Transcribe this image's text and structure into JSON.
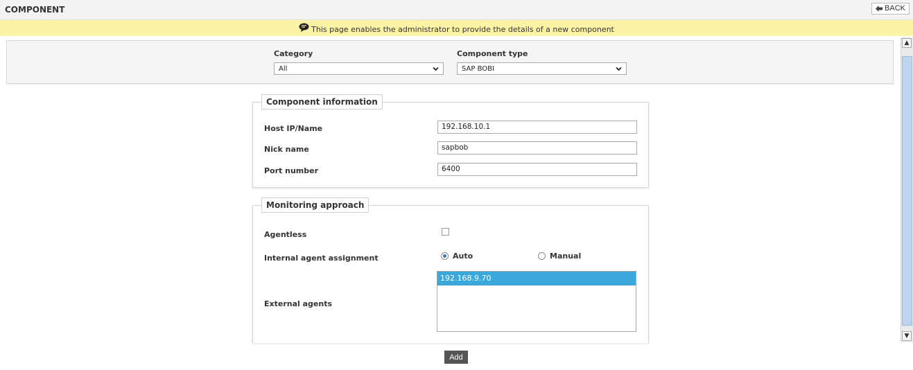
{
  "header": {
    "title": "COMPONENT",
    "back_label": "BACK"
  },
  "info": {
    "message": "This page enables the administrator to provide the details of a new component"
  },
  "filters": {
    "category": {
      "label": "Category",
      "value": "All"
    },
    "component_type": {
      "label": "Component type",
      "value": "SAP BOBI"
    }
  },
  "component_info": {
    "legend": "Component information",
    "fields": [
      {
        "label": "Host IP/Name",
        "value": "192.168.10.1"
      },
      {
        "label": "Nick name",
        "value": "sapbob"
      },
      {
        "label": "Port number",
        "value": "6400"
      }
    ]
  },
  "monitoring": {
    "legend": "Monitoring approach",
    "agentless": {
      "label": "Agentless",
      "checked": false
    },
    "internal_agent": {
      "label": "Internal agent assignment",
      "options": [
        {
          "label": "Auto",
          "selected": true
        },
        {
          "label": "Manual",
          "selected": false
        }
      ]
    },
    "external_agents": {
      "label": "External agents",
      "items": [
        "192.168.9.70"
      ]
    }
  },
  "actions": {
    "add_label": "Add"
  },
  "colors": {
    "info_bar": "#fdf3a4",
    "selected_item": "#3ba8dc",
    "add_button": "#555555"
  }
}
